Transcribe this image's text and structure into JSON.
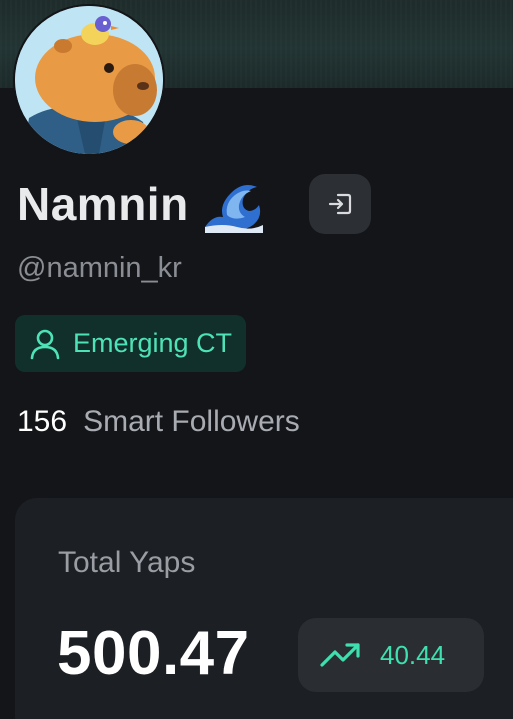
{
  "profile": {
    "name": "Namnin",
    "emoji": "🌊",
    "handle": "@namnin_kr",
    "badge": {
      "label": "Emerging CT",
      "icon": "user-icon",
      "color": "#4ee3b7"
    },
    "smart_followers": {
      "count": "156",
      "label": "Smart Followers"
    }
  },
  "actions": {
    "logout_icon": "logout-icon"
  },
  "yaps_card": {
    "title": "Total Yaps",
    "value": "500.47",
    "trend": {
      "icon": "trending-up-icon",
      "value": "40.44",
      "color": "#3ee0b0"
    }
  }
}
